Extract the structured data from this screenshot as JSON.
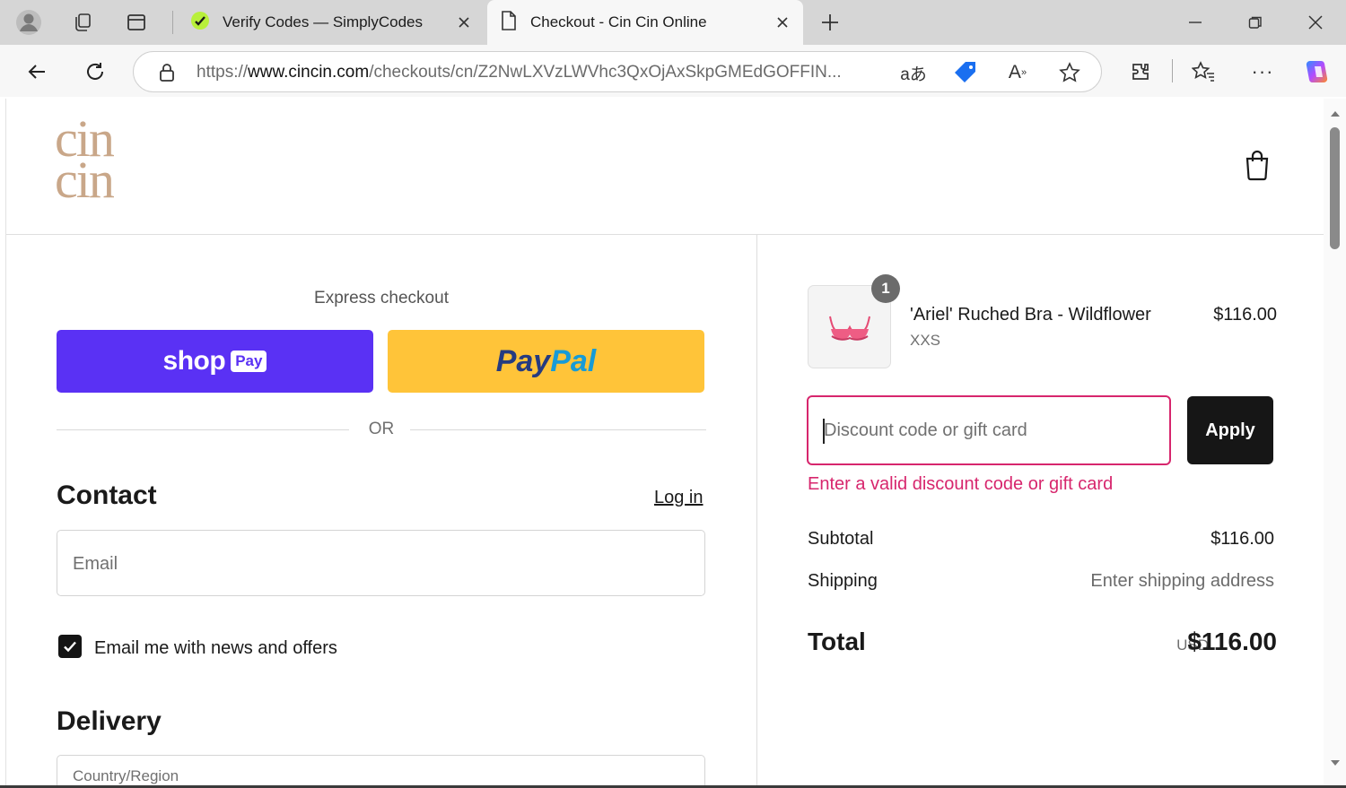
{
  "browser": {
    "tabs": [
      {
        "title": "Verify Codes — SimplyCodes",
        "icon": "simplycodes-icon",
        "active": false
      },
      {
        "title": "Checkout - Cin Cin Online",
        "icon": "page-icon",
        "active": true
      }
    ],
    "url_prefix": "https://",
    "url_host": "www.cincin.com",
    "url_path": "/checkouts/cn/Z2NwLXVzLWVhc3QxOjAxSkpGMEdGOFFIN..."
  },
  "header": {
    "logo_line1": "cin",
    "logo_line2": "cin"
  },
  "express": {
    "label": "Express checkout",
    "shop_word": "shop",
    "shop_pill": "Pay",
    "paypal_a": "Pay",
    "paypal_b": "Pal",
    "or_label": "OR"
  },
  "contact": {
    "heading": "Contact",
    "login_label": "Log in",
    "email_placeholder": "Email",
    "newsletter_label": "Email me with news and offers",
    "newsletter_checked": true
  },
  "delivery": {
    "heading": "Delivery",
    "country_placeholder": "Country/Region"
  },
  "order": {
    "item_qty": "1",
    "item_name": "'Ariel' Ruched Bra - Wildflower",
    "item_variant": "XXS",
    "item_price": "$116.00",
    "discount_placeholder": "Discount code or gift card",
    "apply_label": "Apply",
    "discount_error": "Enter a valid discount code or gift card",
    "subtotal_label": "Subtotal",
    "subtotal_value": "$116.00",
    "shipping_label": "Shipping",
    "shipping_value": "Enter shipping address",
    "total_label": "Total",
    "total_currency": "USD",
    "total_value": "$116.00"
  },
  "colors": {
    "shop_pay": "#5a31f4",
    "paypal": "#ffc439",
    "error": "#d7266d",
    "logo": "#c9a789"
  }
}
